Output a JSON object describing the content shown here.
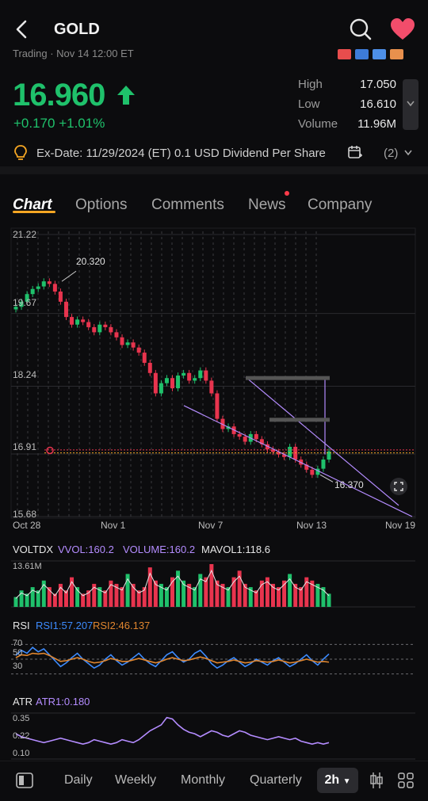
{
  "header": {
    "title": "GOLD",
    "subtitle": "Trading · Nov 14 12:00 ET",
    "flag_colors": [
      "#e84d4d",
      "#3d7bd9",
      "#4d8fe8",
      "#e8904d"
    ]
  },
  "quote": {
    "price": "16.960",
    "change": "+0.170 +1.01%",
    "high_label": "High",
    "high": "17.050",
    "low_label": "Low",
    "low": "16.610",
    "volume_label": "Volume",
    "volume": "11.96M"
  },
  "dividend": {
    "text": "Ex-Date:  11/29/2024 (ET)  0.1 USD Dividend Per Share",
    "count": "(2)"
  },
  "tabs": [
    "Chart",
    "Options",
    "Comments",
    "News",
    "Company"
  ],
  "price_axis": {
    "ticks": [
      "21.22",
      "19.67",
      "18.24",
      "16.91",
      "15.68"
    ],
    "high_marker": "20.320",
    "low_marker": "16.370"
  },
  "x_axis": {
    "ticks": [
      "Oct 28",
      "Nov 1",
      "Nov 7",
      "Nov 13",
      "Nov 19"
    ]
  },
  "volume_panel": {
    "name": "VOLTDX",
    "vvol": "VVOL:160.2",
    "volume": "VOLUME:160.2",
    "mavol": "MAVOL1:118.6",
    "axis_max": "13.61M"
  },
  "rsi_panel": {
    "name": "RSI",
    "rsi1": "RSI1:57.207",
    "rsi2": "RSI2:46.137",
    "levels": [
      "70",
      "50",
      "30"
    ]
  },
  "atr_panel": {
    "name": "ATR",
    "atr1": "ATR1:0.180",
    "ticks": [
      "0.35",
      "0.22",
      "0.10"
    ]
  },
  "bottom_bar": {
    "items": [
      "Daily",
      "Weekly",
      "Monthly",
      "Quarterly"
    ],
    "selected": "2h"
  },
  "colors": {
    "up": "#1fc16b",
    "down": "#e8344e",
    "accent": "#f5a623",
    "rsi1": "#3d8bfd",
    "rsi2": "#e0862f",
    "atr": "#b48cff",
    "trend": "#b48cff"
  },
  "chart_data": {
    "type": "candlestick",
    "price_range": [
      15.68,
      21.22
    ],
    "close_series": [
      19.8,
      19.9,
      20.05,
      20.15,
      20.2,
      20.3,
      20.25,
      20.1,
      19.9,
      19.6,
      19.45,
      19.55,
      19.5,
      19.4,
      19.3,
      19.45,
      19.4,
      19.3,
      19.2,
      19.05,
      19.1,
      19.0,
      18.9,
      18.7,
      18.5,
      18.1,
      18.3,
      18.4,
      18.2,
      18.45,
      18.5,
      18.35,
      18.4,
      18.55,
      18.35,
      18.1,
      17.6,
      17.4,
      17.45,
      17.3,
      17.25,
      17.15,
      17.3,
      17.2,
      17.1,
      17.0,
      16.95,
      16.9,
      16.85,
      17.05,
      16.8,
      16.7,
      16.6,
      16.5,
      16.62,
      16.8,
      16.96
    ],
    "volume_series": [
      3,
      5,
      4,
      6,
      5,
      8,
      6,
      4,
      7,
      5,
      9,
      6,
      4,
      5,
      7,
      6,
      5,
      8,
      7,
      6,
      10,
      7,
      5,
      6,
      12,
      8,
      7,
      6,
      9,
      11,
      8,
      7,
      6,
      10,
      9,
      13,
      8,
      7,
      6,
      9,
      11,
      7,
      6,
      5,
      8,
      9,
      7,
      6,
      8,
      10,
      7,
      6,
      9,
      8,
      7,
      6,
      4
    ],
    "rsi1_series": [
      55,
      62,
      58,
      66,
      60,
      64,
      56,
      48,
      40,
      45,
      52,
      58,
      50,
      44,
      38,
      42,
      50,
      56,
      48,
      42,
      46,
      52,
      58,
      50,
      44,
      40,
      48,
      56,
      60,
      52,
      46,
      50,
      58,
      62,
      54,
      44,
      38,
      42,
      48,
      52,
      46,
      40,
      44,
      50,
      46,
      42,
      48,
      52,
      46,
      40,
      44,
      50,
      56,
      48,
      42,
      50,
      57
    ],
    "rsi2_series": [
      52,
      56,
      55,
      58,
      57,
      58,
      55,
      51,
      47,
      48,
      50,
      52,
      50,
      47,
      45,
      46,
      48,
      51,
      49,
      47,
      47,
      49,
      51,
      49,
      47,
      45,
      47,
      50,
      52,
      50,
      48,
      49,
      51,
      53,
      51,
      48,
      45,
      46,
      47,
      49,
      47,
      45,
      46,
      48,
      47,
      46,
      47,
      49,
      47,
      45,
      46,
      48,
      50,
      48,
      46,
      47,
      46
    ],
    "atr_series": [
      0.24,
      0.22,
      0.21,
      0.2,
      0.19,
      0.18,
      0.19,
      0.2,
      0.21,
      0.2,
      0.19,
      0.18,
      0.17,
      0.18,
      0.2,
      0.19,
      0.18,
      0.17,
      0.18,
      0.2,
      0.19,
      0.18,
      0.2,
      0.23,
      0.26,
      0.28,
      0.3,
      0.35,
      0.34,
      0.3,
      0.27,
      0.25,
      0.24,
      0.22,
      0.24,
      0.26,
      0.25,
      0.23,
      0.22,
      0.24,
      0.26,
      0.25,
      0.23,
      0.22,
      0.21,
      0.2,
      0.21,
      0.22,
      0.21,
      0.2,
      0.21,
      0.19,
      0.18,
      0.17,
      0.18,
      0.17,
      0.18
    ]
  }
}
